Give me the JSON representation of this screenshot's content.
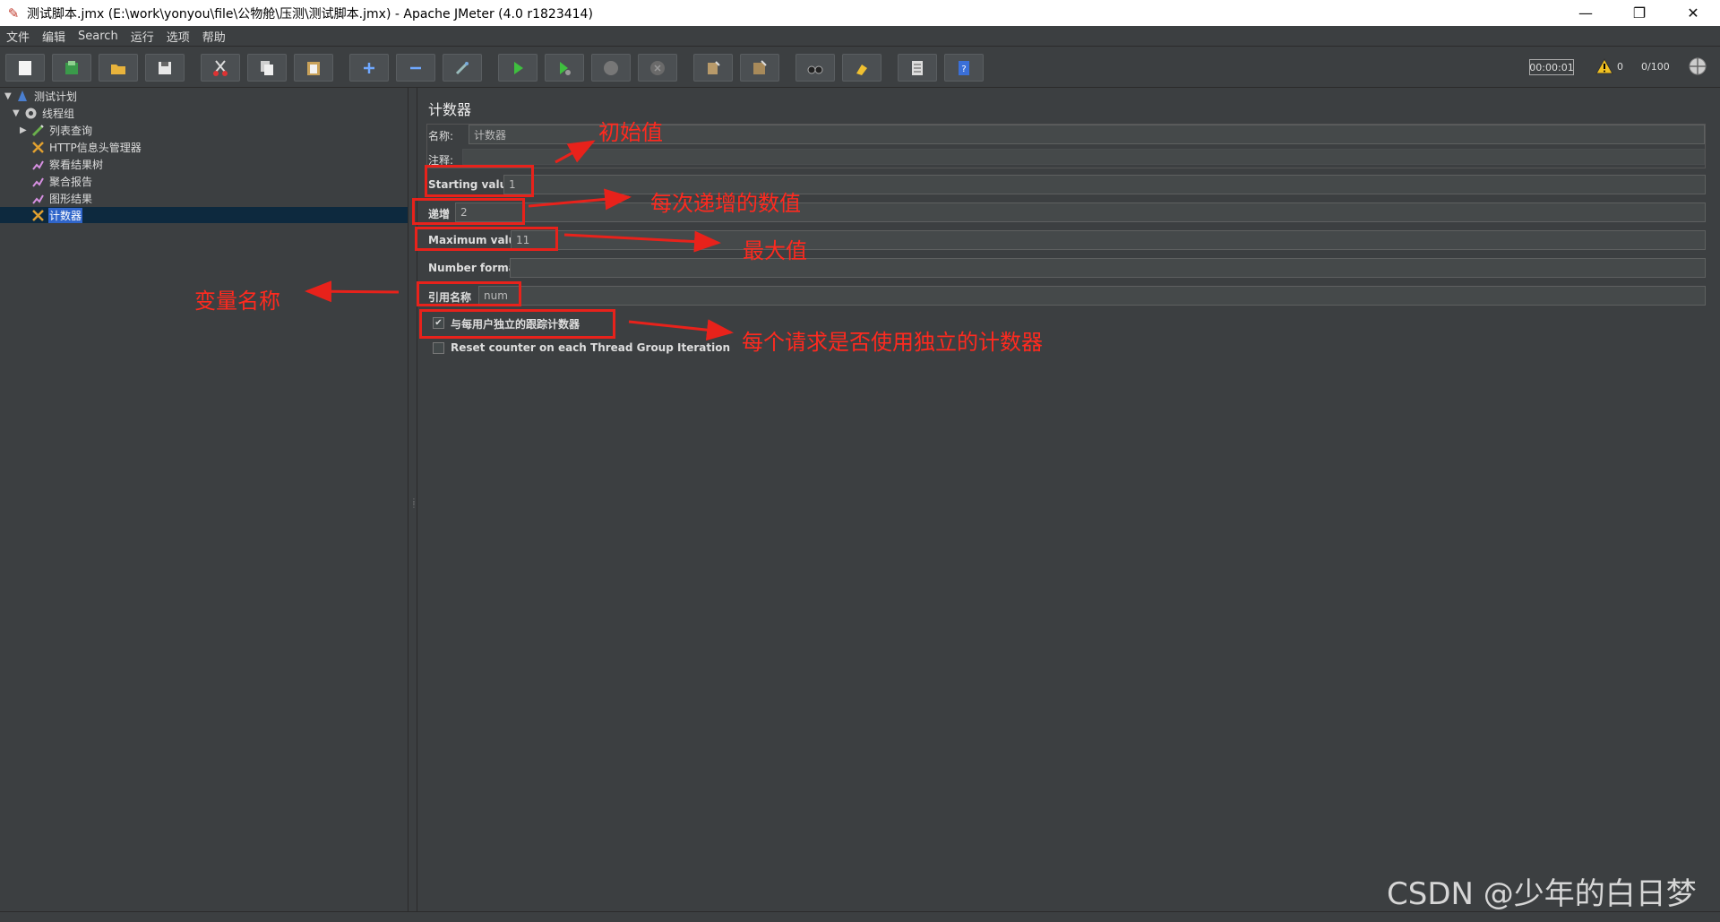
{
  "window": {
    "title": "测试脚本.jmx (E:\\work\\yonyou\\file\\公物舱\\压测\\测试脚本.jmx) - Apache JMeter (4.0 r1823414)",
    "minimize": "—",
    "maximize": "❐",
    "close": "✕"
  },
  "menu": [
    "文件",
    "编辑",
    "Search",
    "运行",
    "选项",
    "帮助"
  ],
  "toolbar": {
    "timer": "00:00:01",
    "warnings": "0",
    "threads": "0/100"
  },
  "tree": {
    "items": [
      {
        "label": "测试计划",
        "icon": "test-plan-icon"
      },
      {
        "label": "线程组",
        "icon": "thread-group-gear-icon"
      },
      {
        "label": "列表查询",
        "icon": "sampler-pen-icon"
      },
      {
        "label": "HTTP信息头管理器",
        "icon": "config-tools-icon"
      },
      {
        "label": "察看结果树",
        "icon": "listener-chart-icon"
      },
      {
        "label": "聚合报告",
        "icon": "listener-chart-icon"
      },
      {
        "label": "图形结果",
        "icon": "listener-chart-icon"
      },
      {
        "label": "计数器",
        "icon": "config-tools-icon"
      }
    ]
  },
  "editor": {
    "title": "计数器",
    "name_label": "名称:",
    "name_value": "计数器",
    "comment_label": "注释:",
    "start_label": "Starting value",
    "start_value": "1",
    "increment_label": "递增",
    "increment_value": "2",
    "max_label": "Maximum value",
    "max_value": "11",
    "format_label": "Number format",
    "format_value": "",
    "ref_label": "引用名称",
    "ref_value": "num",
    "per_user_label": "与每用户独立的跟踪计数器",
    "per_user_checked": true,
    "reset_label": "Reset counter on each Thread Group Iteration",
    "reset_checked": false
  },
  "annotations": {
    "initial": "初始值",
    "increment": "每次递增的数值",
    "max": "最大值",
    "var_name": "变量名称",
    "per_request": "每个请求是否使用独立的计数器",
    "color": "#e8221b"
  },
  "watermark": "CSDN @少年的白日梦"
}
